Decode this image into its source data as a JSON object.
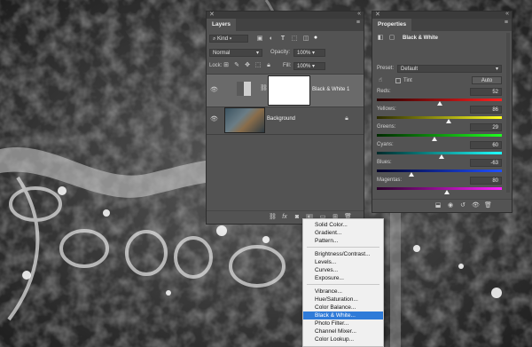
{
  "layers_panel": {
    "close_glyph": "✕",
    "collapse_glyph": "«",
    "tab_label": "Layers",
    "menu_glyph": "≡",
    "kind_filter": "Kind",
    "blend_mode": "Normal",
    "opacity_label": "Opacity:",
    "opacity_value": "100%",
    "lock_label": "Lock:",
    "fill_label": "Fill:",
    "fill_value": "100%",
    "layers": [
      {
        "name": "Black & White 1",
        "visible": true,
        "selected": true
      },
      {
        "name": "Background",
        "visible": true,
        "locked": true
      }
    ],
    "footer_icons": [
      "link-icon",
      "fx-icon",
      "mask-icon",
      "adjustment-icon",
      "folder-icon",
      "new-layer-icon",
      "trash-icon"
    ],
    "fx_label": "fx"
  },
  "properties_panel": {
    "close_glyph": "✕",
    "collapse_glyph": "«",
    "tab_label": "Properties",
    "menu_glyph": "≡",
    "title": "Black & White",
    "preset_label": "Preset:",
    "preset_value": "Default",
    "tint_label": "Tint",
    "auto_label": "Auto",
    "sliders": [
      {
        "label": "Reds:",
        "value": "52",
        "min": -200,
        "max": 300,
        "gradient": "linear-gradient(to right,#2a0000,#ff2020)"
      },
      {
        "label": "Yellows:",
        "value": "86",
        "min": -200,
        "max": 300,
        "gradient": "linear-gradient(to right,#2a2a00,#ffff20)"
      },
      {
        "label": "Greens:",
        "value": "29",
        "min": -200,
        "max": 300,
        "gradient": "linear-gradient(to right,#002a00,#20ff20)"
      },
      {
        "label": "Cyans:",
        "value": "60",
        "min": -200,
        "max": 300,
        "gradient": "linear-gradient(to right,#002a2a,#20ffff)"
      },
      {
        "label": "Blues:",
        "value": "-63",
        "min": -200,
        "max": 300,
        "gradient": "linear-gradient(to right,#00002a,#2050ff)"
      },
      {
        "label": "Magentas:",
        "value": "80",
        "min": -200,
        "max": 300,
        "gradient": "linear-gradient(to right,#2a002a,#ff20ff)"
      }
    ]
  },
  "adjustment_menu": {
    "groups": [
      [
        "Solid Color...",
        "Gradient...",
        "Pattern..."
      ],
      [
        "Brightness/Contrast...",
        "Levels...",
        "Curves...",
        "Exposure..."
      ],
      [
        "Vibrance...",
        "Hue/Saturation...",
        "Color Balance...",
        "Black & White...",
        "Photo Filter...",
        "Channel Mixer...",
        "Color Lookup..."
      ]
    ],
    "highlighted": "Black & White..."
  },
  "colors": {
    "panel_bg": "#535353",
    "menu_highlight": "#2f7bd8",
    "selected_layer": "#6a6a6a"
  }
}
